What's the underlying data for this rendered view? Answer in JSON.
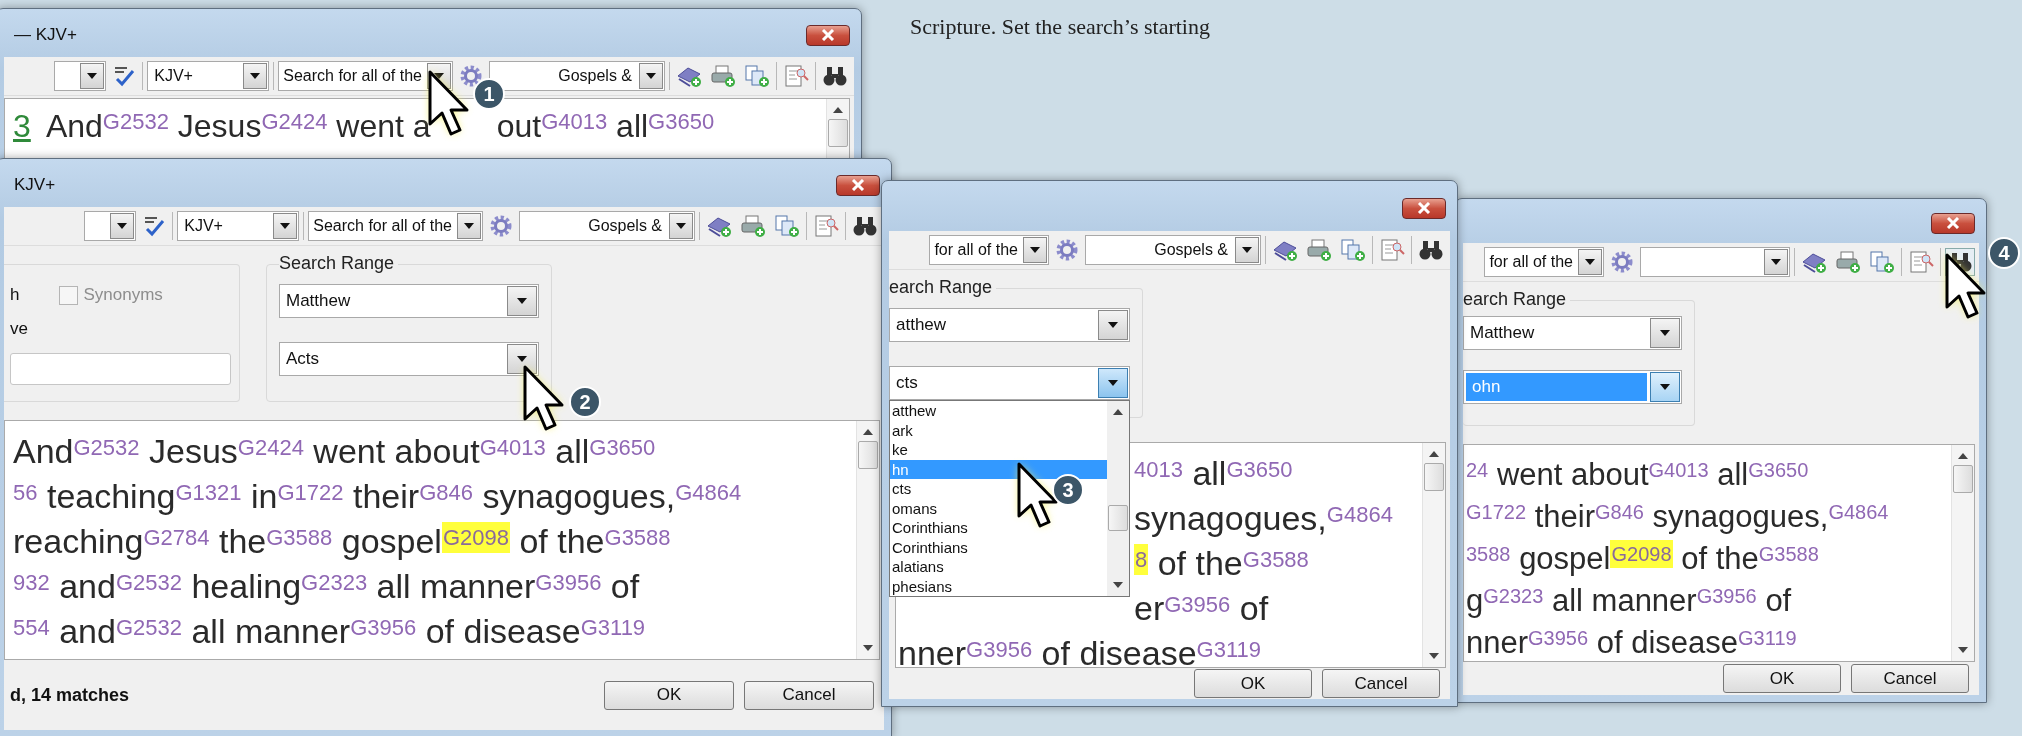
{
  "caption": "Scripture. Set the search’s starting",
  "windows": [
    {
      "title": "— KJV+",
      "toolbar": [
        {
          "kind": "combo"
        },
        {
          "kind": "spell"
        },
        {
          "kind": "sep"
        },
        {
          "kind": "module-combo",
          "value": "KJV+"
        },
        {
          "kind": "sep"
        },
        {
          "kind": "mode-combo",
          "value": "Search for all of the"
        },
        {
          "kind": "gear"
        },
        {
          "kind": "scope-combo",
          "value": "Gospels &"
        },
        {
          "kind": "sep"
        },
        {
          "kind": "book"
        },
        {
          "kind": "print"
        },
        {
          "kind": "copy"
        },
        {
          "kind": "sep"
        },
        {
          "kind": "export"
        },
        {
          "kind": "sep"
        },
        {
          "kind": "find",
          "highlighted": false
        }
      ],
      "lines": [
        {
          "segments": [
            {
              "text": "3",
              "kind": "verse"
            },
            {
              "text": "And",
              "kind": "word"
            },
            {
              "text": "G2532",
              "kind": "strong"
            },
            {
              "text": "Jesus",
              "kind": "word"
            },
            {
              "text": "G2424",
              "kind": "strong"
            },
            {
              "text": "went a",
              "kind": "word"
            }
          ],
          "segments_after_cursor": [
            {
              "text": "out",
              "kind": "word"
            },
            {
              "text": "G4013",
              "kind": "strong"
            },
            {
              "text": "all",
              "kind": "word"
            },
            {
              "text": "G3650",
              "kind": "strong"
            }
          ]
        }
      ]
    },
    {
      "title": "KJV+",
      "toolbar": [
        {
          "kind": "combo"
        },
        {
          "kind": "spell"
        },
        {
          "kind": "sep"
        },
        {
          "kind": "module-combo",
          "value": "KJV+"
        },
        {
          "kind": "sep"
        },
        {
          "kind": "mode-combo",
          "value": "Search for all of the"
        },
        {
          "kind": "gear"
        },
        {
          "kind": "scope-combo",
          "value": "Gospels &"
        },
        {
          "kind": "sep"
        },
        {
          "kind": "book"
        },
        {
          "kind": "print"
        },
        {
          "kind": "copy"
        },
        {
          "kind": "sep"
        },
        {
          "kind": "export"
        },
        {
          "kind": "sep"
        },
        {
          "kind": "find",
          "highlighted": false
        }
      ],
      "options": {
        "left": {
          "row_1": "h",
          "checkbox": {
            "label": "Synonyms",
            "checked": false,
            "disabled": true
          },
          "row_2": "ve"
        },
        "range": {
          "title": "Search Range",
          "from": "Matthew",
          "to": "Acts",
          "open": false,
          "highlighted": false
        }
      },
      "lines": [
        {
          "segments": [
            {
              "text": "And",
              "kind": "word"
            },
            {
              "text": "G2532",
              "kind": "strong"
            },
            {
              "text": "Jesus",
              "kind": "word"
            },
            {
              "text": "G2424",
              "kind": "strong"
            },
            {
              "text": "went about",
              "kind": "word"
            },
            {
              "text": "G4013",
              "kind": "strong"
            },
            {
              "text": "all",
              "kind": "word"
            },
            {
              "text": "G3650",
              "kind": "strong"
            }
          ]
        },
        {
          "segments": [
            {
              "text": "56",
              "kind": "strong"
            },
            {
              "text": "teaching",
              "kind": "word"
            },
            {
              "text": "G1321",
              "kind": "strong"
            },
            {
              "text": "in",
              "kind": "word"
            },
            {
              "text": "G1722",
              "kind": "strong"
            },
            {
              "text": "their",
              "kind": "word"
            },
            {
              "text": "G846",
              "kind": "strong"
            },
            {
              "text": "synagogues,",
              "kind": "word"
            },
            {
              "text": "G4864",
              "kind": "strong"
            }
          ]
        },
        {
          "segments": [
            {
              "text": "reaching",
              "kind": "word"
            },
            {
              "text": "G2784",
              "kind": "strong"
            },
            {
              "text": "the",
              "kind": "word"
            },
            {
              "text": "G3588",
              "kind": "strong"
            },
            {
              "text": "gospel",
              "kind": "word"
            },
            {
              "text": "G2098",
              "kind": "match"
            },
            {
              "text": "of the",
              "kind": "word"
            },
            {
              "text": "G3588",
              "kind": "strong"
            }
          ]
        },
        {
          "segments": [
            {
              "text": "932",
              "kind": "strong"
            },
            {
              "text": "and",
              "kind": "word"
            },
            {
              "text": "G2532",
              "kind": "strong"
            },
            {
              "text": "healing",
              "kind": "word"
            },
            {
              "text": "G2323",
              "kind": "strong"
            },
            {
              "text": "all manner",
              "kind": "word"
            },
            {
              "text": "G3956",
              "kind": "strong"
            },
            {
              "text": "of",
              "kind": "word"
            }
          ]
        },
        {
          "segments": [
            {
              "text": "554",
              "kind": "strong"
            },
            {
              "text": "and",
              "kind": "word"
            },
            {
              "text": "G2532",
              "kind": "strong"
            },
            {
              "text": "all manner",
              "kind": "word"
            },
            {
              "text": "G3956",
              "kind": "strong"
            },
            {
              "text": "of disease",
              "kind": "word"
            },
            {
              "text": "G3119",
              "kind": "strong"
            }
          ]
        }
      ],
      "status": "d, 14 matches",
      "buttons": [
        "OK",
        "Cancel"
      ]
    },
    {
      "toolbar": [
        {
          "kind": "mode-combo",
          "value": "for all of the"
        },
        {
          "kind": "gear"
        },
        {
          "kind": "scope-combo",
          "value": "Gospels &"
        },
        {
          "kind": "sep"
        },
        {
          "kind": "book"
        },
        {
          "kind": "print"
        },
        {
          "kind": "copy"
        },
        {
          "kind": "sep"
        },
        {
          "kind": "export"
        },
        {
          "kind": "sep"
        },
        {
          "kind": "find",
          "highlighted": false
        }
      ],
      "options": {
        "range": {
          "title": "earch Range",
          "from": "atthew",
          "to": "cts",
          "open": true,
          "highlighted": false,
          "list": [
            {
              "label": "atthew",
              "selected": false
            },
            {
              "label": "ark",
              "selected": false
            },
            {
              "label": "ke",
              "selected": false
            },
            {
              "label": "hn",
              "selected": true
            },
            {
              "label": "cts",
              "selected": false
            },
            {
              "label": "omans",
              "selected": false
            },
            {
              "label": "Corinthians",
              "selected": false
            },
            {
              "label": "Corinthians",
              "selected": false
            },
            {
              "label": "alatians",
              "selected": false
            },
            {
              "label": "phesians",
              "selected": false
            }
          ]
        }
      },
      "lines": [
        {
          "beside_list": true,
          "segments": [
            {
              "text": "4013",
              "kind": "strong"
            },
            {
              "text": "all",
              "kind": "word"
            },
            {
              "text": "G3650",
              "kind": "strong"
            }
          ]
        },
        {
          "beside_list": true,
          "segments": [
            {
              "text": "synagogues,",
              "kind": "word"
            },
            {
              "text": "G4864",
              "kind": "strong"
            }
          ]
        },
        {
          "beside_list": true,
          "segments": [
            {
              "text": "8",
              "kind": "match"
            },
            {
              "text": "of the",
              "kind": "word"
            },
            {
              "text": "G3588",
              "kind": "strong"
            }
          ]
        },
        {
          "beside_list": true,
          "segments": [
            {
              "text": "er",
              "kind": "word"
            },
            {
              "text": "G3956",
              "kind": "strong"
            },
            {
              "text": "of",
              "kind": "word"
            }
          ]
        },
        {
          "beside_list": false,
          "segments": [
            {
              "text": "nner",
              "kind": "word"
            },
            {
              "text": "G3956",
              "kind": "strong"
            },
            {
              "text": "of disease",
              "kind": "word"
            },
            {
              "text": "G3119",
              "kind": "strong"
            }
          ]
        }
      ],
      "buttons": [
        "OK",
        "Cancel"
      ]
    },
    {
      "toolbar": [
        {
          "kind": "mode-combo",
          "value": "for all of the"
        },
        {
          "kind": "gear"
        },
        {
          "kind": "scope-combo"
        },
        {
          "kind": "sep"
        },
        {
          "kind": "book"
        },
        {
          "kind": "print"
        },
        {
          "kind": "copy"
        },
        {
          "kind": "sep"
        },
        {
          "kind": "export"
        },
        {
          "kind": "sep"
        },
        {
          "kind": "find",
          "highlighted": true
        }
      ],
      "options": {
        "range": {
          "title": "earch Range",
          "from": "Matthew",
          "to": "ohn",
          "open": false,
          "highlighted": true
        }
      },
      "lines": [
        {
          "segments": [
            {
              "text": "24",
              "kind": "strong"
            },
            {
              "text": "went about",
              "kind": "word"
            },
            {
              "text": "G4013",
              "kind": "strong"
            },
            {
              "text": "all",
              "kind": "word"
            },
            {
              "text": "G3650",
              "kind": "strong"
            }
          ]
        },
        {
          "segments": [
            {
              "text": "G1722",
              "kind": "strong"
            },
            {
              "text": "their",
              "kind": "word"
            },
            {
              "text": "G846",
              "kind": "strong"
            },
            {
              "text": "synagogues,",
              "kind": "word"
            },
            {
              "text": "G4864",
              "kind": "strong"
            }
          ]
        },
        {
          "segments": [
            {
              "text": "3588",
              "kind": "strong"
            },
            {
              "text": "gospel",
              "kind": "word"
            },
            {
              "text": "G2098",
              "kind": "match"
            },
            {
              "text": "of the",
              "kind": "word"
            },
            {
              "text": "G3588",
              "kind": "strong"
            }
          ]
        },
        {
          "segments": [
            {
              "text": "g",
              "kind": "word"
            },
            {
              "text": "G2323",
              "kind": "strong"
            },
            {
              "text": "all manner",
              "kind": "word"
            },
            {
              "text": "G3956",
              "kind": "strong"
            },
            {
              "text": "of",
              "kind": "word"
            }
          ]
        },
        {
          "segments": [
            {
              "text": "nner",
              "kind": "word"
            },
            {
              "text": "G3956",
              "kind": "strong"
            },
            {
              "text": "of disease",
              "kind": "word"
            },
            {
              "text": "G3119",
              "kind": "strong"
            }
          ]
        }
      ],
      "buttons": [
        "OK",
        "Cancel"
      ]
    }
  ],
  "callouts": [
    {
      "number": "1"
    },
    {
      "number": "2"
    },
    {
      "number": "3"
    },
    {
      "number": "4"
    }
  ]
}
